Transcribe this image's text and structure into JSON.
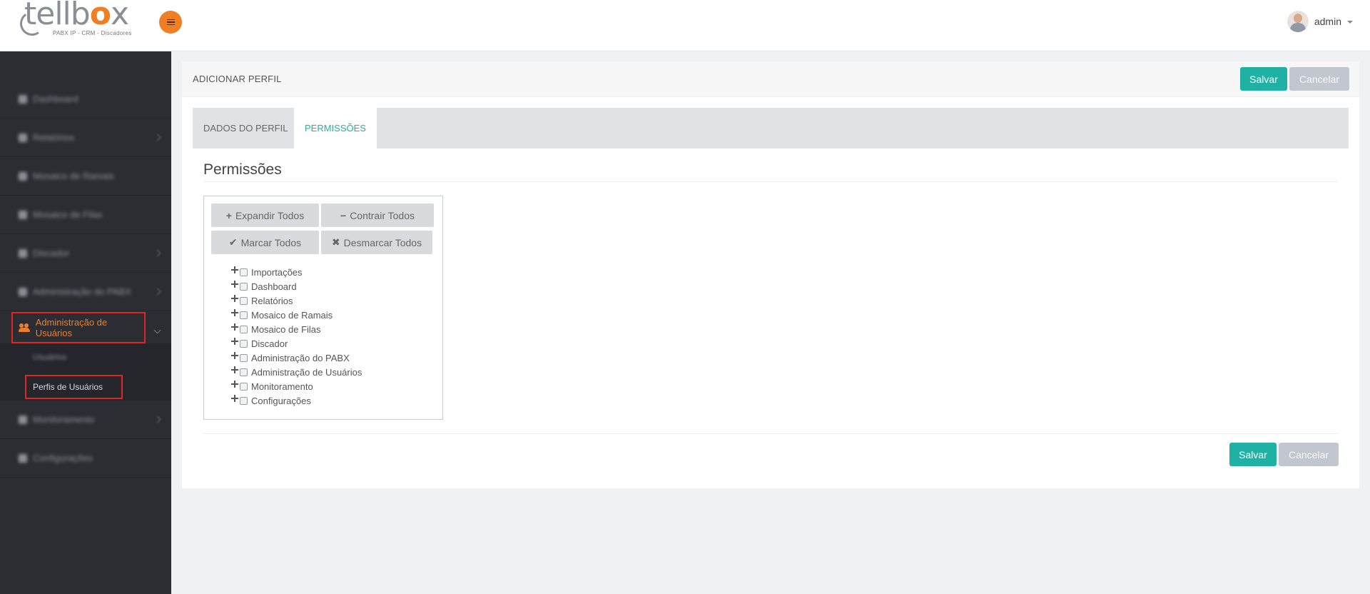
{
  "brand": {
    "logo_main": "tellb",
    "logo_x": "o",
    "logo_end": "x",
    "logo_sub": "PABX IP - CRM - Discadores",
    "accent": "#f07f24",
    "teal": "#1fb1a3"
  },
  "topbar": {
    "menu_icon": "hamburger-icon",
    "user_name": "admin"
  },
  "sidebar": {
    "items": [
      {
        "label": "Dashboard"
      },
      {
        "label": "Relatórios"
      },
      {
        "label": "Mosaico de Ramais"
      },
      {
        "label": "Mosaico de Filas"
      },
      {
        "label": "Discador"
      },
      {
        "label": "Administração do PABX"
      },
      {
        "label": "Administração de Usuários"
      },
      {
        "label": "Monitoramento"
      },
      {
        "label": "Configurações"
      }
    ],
    "submenu": {
      "usuarios": "Usuários",
      "perfis": "Perfis de Usuários"
    }
  },
  "panel": {
    "title": "ADICIONAR PERFIL",
    "save_label": "Salvar",
    "cancel_label": "Cancelar",
    "tabs": [
      {
        "label": "DADOS DO PERFIL"
      },
      {
        "label": "PERMISSÕES"
      }
    ],
    "section_title": "Permissões",
    "tree_buttons": {
      "expand": "Expandir Todos",
      "collapse": "Contrair Todos",
      "check": "Marcar Todos",
      "uncheck": "Desmarcar Todos"
    },
    "tree_items": [
      "Importações",
      "Dashboard",
      "Relatórios",
      "Mosaico de Ramais",
      "Mosaico de Filas",
      "Discador",
      "Administração do PABX",
      "Administração de Usuários",
      "Monitoramento",
      "Configurações"
    ]
  }
}
